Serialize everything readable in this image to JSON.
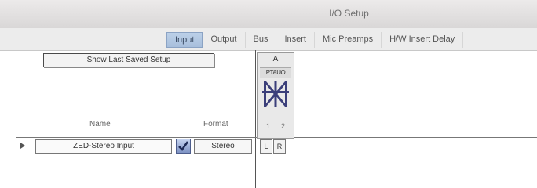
{
  "window": {
    "title": "I/O Setup"
  },
  "tabs": [
    {
      "label": "Input",
      "active": true
    },
    {
      "label": "Output",
      "active": false
    },
    {
      "label": "Bus",
      "active": false
    },
    {
      "label": "Insert",
      "active": false
    },
    {
      "label": "Mic Preamps",
      "active": false
    },
    {
      "label": "H/W Insert Delay",
      "active": false
    }
  ],
  "setup_button": {
    "label": "Show Last Saved Setup"
  },
  "columns": {
    "name": "Name",
    "format": "Format"
  },
  "matrix": {
    "interface_label": "A",
    "strip_label": "PTAUO",
    "channels": [
      "1",
      "2"
    ]
  },
  "rows": [
    {
      "name": "ZED-Stereo Input",
      "enabled": true,
      "format": "Stereo",
      "channels": [
        "L",
        "R"
      ]
    }
  ],
  "colors": {
    "active_tab": "#a8bfdc",
    "checkbox": "#7e93c4",
    "logo": "#3b3f7a"
  }
}
